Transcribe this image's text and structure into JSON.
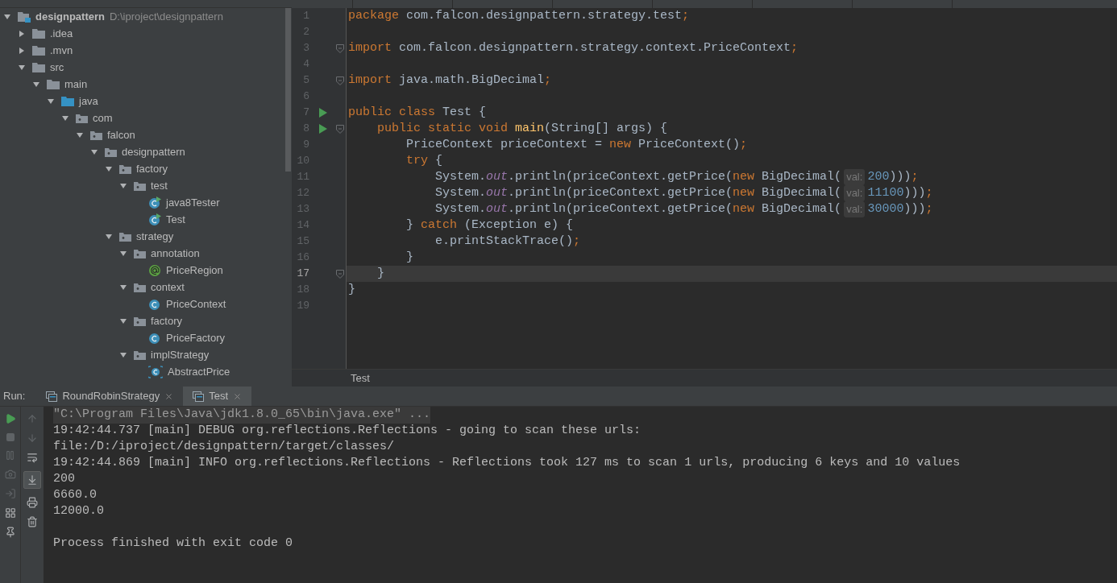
{
  "project_tree": [
    {
      "label": "designpattern",
      "path": "D:\\iproject\\designpattern",
      "kind": "module",
      "expanded": true,
      "children": [
        {
          "label": ".idea",
          "kind": "folder",
          "expanded": false
        },
        {
          "label": ".mvn",
          "kind": "folder",
          "expanded": false
        },
        {
          "label": "src",
          "kind": "folder",
          "expanded": true,
          "children": [
            {
              "label": "main",
              "kind": "folder",
              "expanded": true,
              "children": [
                {
                  "label": "java",
                  "kind": "source",
                  "expanded": true,
                  "children": [
                    {
                      "label": "com",
                      "kind": "package",
                      "expanded": true,
                      "children": [
                        {
                          "label": "falcon",
                          "kind": "package",
                          "expanded": true,
                          "children": [
                            {
                              "label": "designpattern",
                              "kind": "package",
                              "expanded": true,
                              "children": [
                                {
                                  "label": "factory",
                                  "kind": "package",
                                  "expanded": true,
                                  "children": [
                                    {
                                      "label": "test",
                                      "kind": "package",
                                      "expanded": true,
                                      "children": [
                                        {
                                          "label": "java8Tester",
                                          "kind": "runnable-class"
                                        },
                                        {
                                          "label": "Test",
                                          "kind": "runnable-class"
                                        }
                                      ]
                                    }
                                  ]
                                },
                                {
                                  "label": "strategy",
                                  "kind": "package",
                                  "expanded": true,
                                  "children": [
                                    {
                                      "label": "annotation",
                                      "kind": "package",
                                      "expanded": true,
                                      "children": [
                                        {
                                          "label": "PriceRegion",
                                          "kind": "annotation"
                                        }
                                      ]
                                    },
                                    {
                                      "label": "context",
                                      "kind": "package",
                                      "expanded": true,
                                      "children": [
                                        {
                                          "label": "PriceContext",
                                          "kind": "class"
                                        }
                                      ]
                                    },
                                    {
                                      "label": "factory",
                                      "kind": "package",
                                      "expanded": true,
                                      "children": [
                                        {
                                          "label": "PriceFactory",
                                          "kind": "class"
                                        }
                                      ]
                                    },
                                    {
                                      "label": "implStrategy",
                                      "kind": "package",
                                      "expanded": true,
                                      "children": [
                                        {
                                          "label": "AbstractPrice",
                                          "kind": "abstract-class"
                                        }
                                      ]
                                    }
                                  ]
                                }
                              ]
                            }
                          ]
                        }
                      ]
                    }
                  ]
                }
              ]
            }
          ]
        }
      ]
    }
  ],
  "editor": {
    "lines": [
      {
        "number": "1",
        "run": false,
        "fold": false,
        "current": false,
        "tokens": [
          {
            "kind": "keyword",
            "text": "package"
          },
          {
            "kind": "plain",
            "text": " com.falcon.designpattern.strategy.test"
          },
          {
            "kind": "keyword",
            "text": ";"
          }
        ]
      },
      {
        "number": "2",
        "run": false,
        "fold": false,
        "current": false
      },
      {
        "number": "3",
        "run": false,
        "fold": true,
        "current": false,
        "tokens": [
          {
            "kind": "keyword",
            "text": "import"
          },
          {
            "kind": "plain",
            "text": " com.falcon.designpattern.strategy.context.PriceContext"
          },
          {
            "kind": "keyword",
            "text": ";"
          }
        ]
      },
      {
        "number": "4",
        "run": false,
        "fold": false,
        "current": false
      },
      {
        "number": "5",
        "run": false,
        "fold": true,
        "current": false,
        "tokens": [
          {
            "kind": "keyword",
            "text": "import"
          },
          {
            "kind": "plain",
            "text": " java.math.BigDecimal"
          },
          {
            "kind": "keyword",
            "text": ";"
          }
        ]
      },
      {
        "number": "6",
        "run": false,
        "fold": false,
        "current": false
      },
      {
        "number": "7",
        "run": true,
        "fold": false,
        "current": false,
        "tokens": [
          {
            "kind": "keyword",
            "text": "public class "
          },
          {
            "kind": "plain",
            "text": "Test {"
          }
        ]
      },
      {
        "number": "8",
        "run": true,
        "fold": true,
        "current": false,
        "tokens": [
          {
            "kind": "keyword",
            "text": "    public static void "
          },
          {
            "kind": "method",
            "text": "main"
          },
          {
            "kind": "plain",
            "text": "(String[] args) {"
          }
        ]
      },
      {
        "number": "9",
        "run": false,
        "fold": false,
        "current": false,
        "tokens": [
          {
            "kind": "plain",
            "text": "        PriceContext priceContext = "
          },
          {
            "kind": "keyword",
            "text": "new "
          },
          {
            "kind": "plain",
            "text": "PriceContext()"
          },
          {
            "kind": "keyword",
            "text": ";"
          }
        ]
      },
      {
        "number": "10",
        "run": false,
        "fold": false,
        "current": false,
        "tokens": [
          {
            "kind": "keyword",
            "text": "        try"
          },
          {
            "kind": "plain",
            "text": " {"
          }
        ]
      },
      {
        "number": "11",
        "run": false,
        "fold": false,
        "current": false,
        "tokens": [
          {
            "kind": "plain",
            "text": "            System."
          },
          {
            "kind": "field",
            "text": "out"
          },
          {
            "kind": "plain",
            "text": ".println(priceContext.getPrice("
          },
          {
            "kind": "keyword",
            "text": "new "
          },
          {
            "kind": "plain",
            "text": "BigDecimal("
          },
          {
            "kind": "hint",
            "text": "val:"
          },
          {
            "kind": "number",
            "text": "200"
          },
          {
            "kind": "plain",
            "text": ")))"
          },
          {
            "kind": "keyword",
            "text": ";"
          }
        ]
      },
      {
        "number": "12",
        "run": false,
        "fold": false,
        "current": false,
        "tokens": [
          {
            "kind": "plain",
            "text": "            System."
          },
          {
            "kind": "field",
            "text": "out"
          },
          {
            "kind": "plain",
            "text": ".println(priceContext.getPrice("
          },
          {
            "kind": "keyword",
            "text": "new "
          },
          {
            "kind": "plain",
            "text": "BigDecimal("
          },
          {
            "kind": "hint",
            "text": "val:"
          },
          {
            "kind": "number",
            "text": "11100"
          },
          {
            "kind": "plain",
            "text": ")))"
          },
          {
            "kind": "keyword",
            "text": ";"
          }
        ]
      },
      {
        "number": "13",
        "run": false,
        "fold": false,
        "current": false,
        "tokens": [
          {
            "kind": "plain",
            "text": "            System."
          },
          {
            "kind": "field",
            "text": "out"
          },
          {
            "kind": "plain",
            "text": ".println(priceContext.getPrice("
          },
          {
            "kind": "keyword",
            "text": "new "
          },
          {
            "kind": "plain",
            "text": "BigDecimal("
          },
          {
            "kind": "hint",
            "text": "val:"
          },
          {
            "kind": "number",
            "text": "30000"
          },
          {
            "kind": "plain",
            "text": ")))"
          },
          {
            "kind": "keyword",
            "text": ";"
          }
        ]
      },
      {
        "number": "14",
        "run": false,
        "fold": false,
        "current": false,
        "tokens": [
          {
            "kind": "plain",
            "text": "        } "
          },
          {
            "kind": "keyword",
            "text": "catch"
          },
          {
            "kind": "plain",
            "text": " (Exception e) {"
          }
        ]
      },
      {
        "number": "15",
        "run": false,
        "fold": false,
        "current": false,
        "tokens": [
          {
            "kind": "plain",
            "text": "            e.printStackTrace()"
          },
          {
            "kind": "keyword",
            "text": ";"
          }
        ]
      },
      {
        "number": "16",
        "run": false,
        "fold": false,
        "current": false,
        "tokens": [
          {
            "kind": "plain",
            "text": "        }"
          }
        ]
      },
      {
        "number": "17",
        "run": false,
        "fold": true,
        "current": true,
        "tokens": [
          {
            "kind": "plain",
            "text": "    }"
          }
        ]
      },
      {
        "number": "18",
        "run": false,
        "fold": false,
        "current": false,
        "tokens": [
          {
            "kind": "plain",
            "text": "}"
          }
        ]
      },
      {
        "number": "19",
        "run": false,
        "fold": false,
        "current": false
      }
    ],
    "breadcrumb": "Test"
  },
  "run_panel": {
    "label": "Run:",
    "tabs": [
      {
        "label": "RoundRobinStrategy",
        "selected": false
      },
      {
        "label": "Test",
        "selected": true
      }
    ],
    "console": [
      {
        "kind": "command",
        "text": "\"C:\\Program Files\\Java\\jdk1.8.0_65\\bin\\java.exe\" ..."
      },
      {
        "kind": "output",
        "text": "19:42:44.737 [main] DEBUG org.reflections.Reflections - going to scan these urls:"
      },
      {
        "kind": "output",
        "text": "file:/D:/iproject/designpattern/target/classes/"
      },
      {
        "kind": "output",
        "text": "19:42:44.869 [main] INFO org.reflections.Reflections - Reflections took 127 ms to scan 1 urls, producing 6 keys and 10 values"
      },
      {
        "kind": "output",
        "text": "200"
      },
      {
        "kind": "output",
        "text": "6660.0"
      },
      {
        "kind": "output",
        "text": "12000.0"
      },
      {
        "kind": "blank"
      },
      {
        "kind": "output",
        "text": "Process finished with exit code 0"
      }
    ]
  }
}
